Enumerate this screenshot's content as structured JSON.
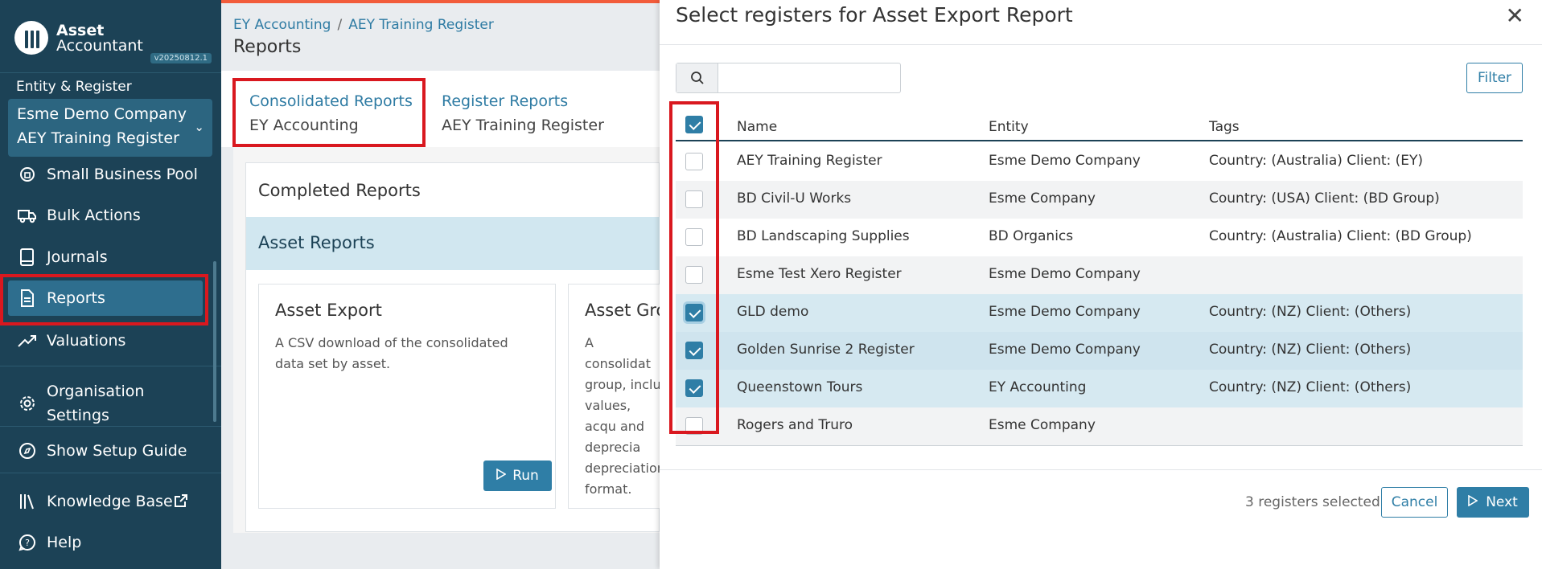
{
  "app": {
    "logo_line1": "Asset",
    "logo_line2": "Accountant",
    "version": "v20250812.1"
  },
  "sidebar": {
    "entity_label": "Entity & Register",
    "entity_name": "Esme Demo Company",
    "register_name": "AEY Training Register",
    "items": [
      {
        "label": "Small Business Pool",
        "icon": "pool-icon"
      },
      {
        "label": "Bulk Actions",
        "icon": "truck-icon"
      },
      {
        "label": "Journals",
        "icon": "book-icon"
      },
      {
        "label": "Reports",
        "icon": "document-icon"
      },
      {
        "label": "Valuations",
        "icon": "trend-up-icon"
      },
      {
        "label": "Organisation Settings",
        "icon": "gear-icon"
      },
      {
        "label": "Show Setup Guide",
        "icon": "compass-icon"
      },
      {
        "label": "Knowledge Base",
        "icon": "library-icon"
      },
      {
        "label": "Help",
        "icon": "help-icon"
      }
    ]
  },
  "main": {
    "breadcrumb": [
      "EY Accounting",
      "AEY Training Register"
    ],
    "title": "Reports",
    "tabs": [
      {
        "label": "Consolidated Reports",
        "sub": "EY Accounting"
      },
      {
        "label": "Register Reports",
        "sub": "AEY Training Register"
      }
    ],
    "completed_label": "Completed Reports",
    "section_label": "Asset Reports",
    "cards": [
      {
        "title": "Asset Export",
        "desc": "A CSV download of the consolidated data set by asset.",
        "button": "Run"
      },
      {
        "title": "Asset Gro",
        "desc": "A consolidat group, inclu values, acqu and deprecia depreciation format."
      }
    ]
  },
  "modal": {
    "title": "Select registers for Asset Export Report",
    "filter_label": "Filter",
    "search_value": "",
    "columns": [
      "Name",
      "Entity",
      "Tags"
    ],
    "rows": [
      {
        "name": "AEY Training Register",
        "entity": "Esme Demo Company",
        "tags": "Country: (Australia) Client: (EY)",
        "checked": false
      },
      {
        "name": "BD Civil-U Works",
        "entity": "Esme Company",
        "tags": "Country: (USA) Client: (BD Group)",
        "checked": false
      },
      {
        "name": "BD Landscaping Supplies",
        "entity": "BD Organics",
        "tags": "Country: (Australia) Client: (BD Group)",
        "checked": false
      },
      {
        "name": "Esme Test Xero Register",
        "entity": "Esme Demo Company",
        "tags": "",
        "checked": false
      },
      {
        "name": "GLD demo",
        "entity": "Esme Demo Company",
        "tags": "Country: (NZ) Client: (Others)",
        "checked": true
      },
      {
        "name": "Golden Sunrise 2 Register",
        "entity": "Esme Demo Company",
        "tags": "Country: (NZ) Client: (Others)",
        "checked": true
      },
      {
        "name": "Queenstown Tours",
        "entity": "EY Accounting",
        "tags": "Country: (NZ) Client: (Others)",
        "checked": true
      },
      {
        "name": "Rogers and Truro",
        "entity": "Esme Company",
        "tags": "",
        "checked": false
      }
    ],
    "selected_count_text": "3 registers selected",
    "cancel_label": "Cancel",
    "next_label": "Next"
  },
  "colors": {
    "sidebar_bg": "#1c4256",
    "accent": "#2f7ea6",
    "highlight": "#d9181f"
  }
}
